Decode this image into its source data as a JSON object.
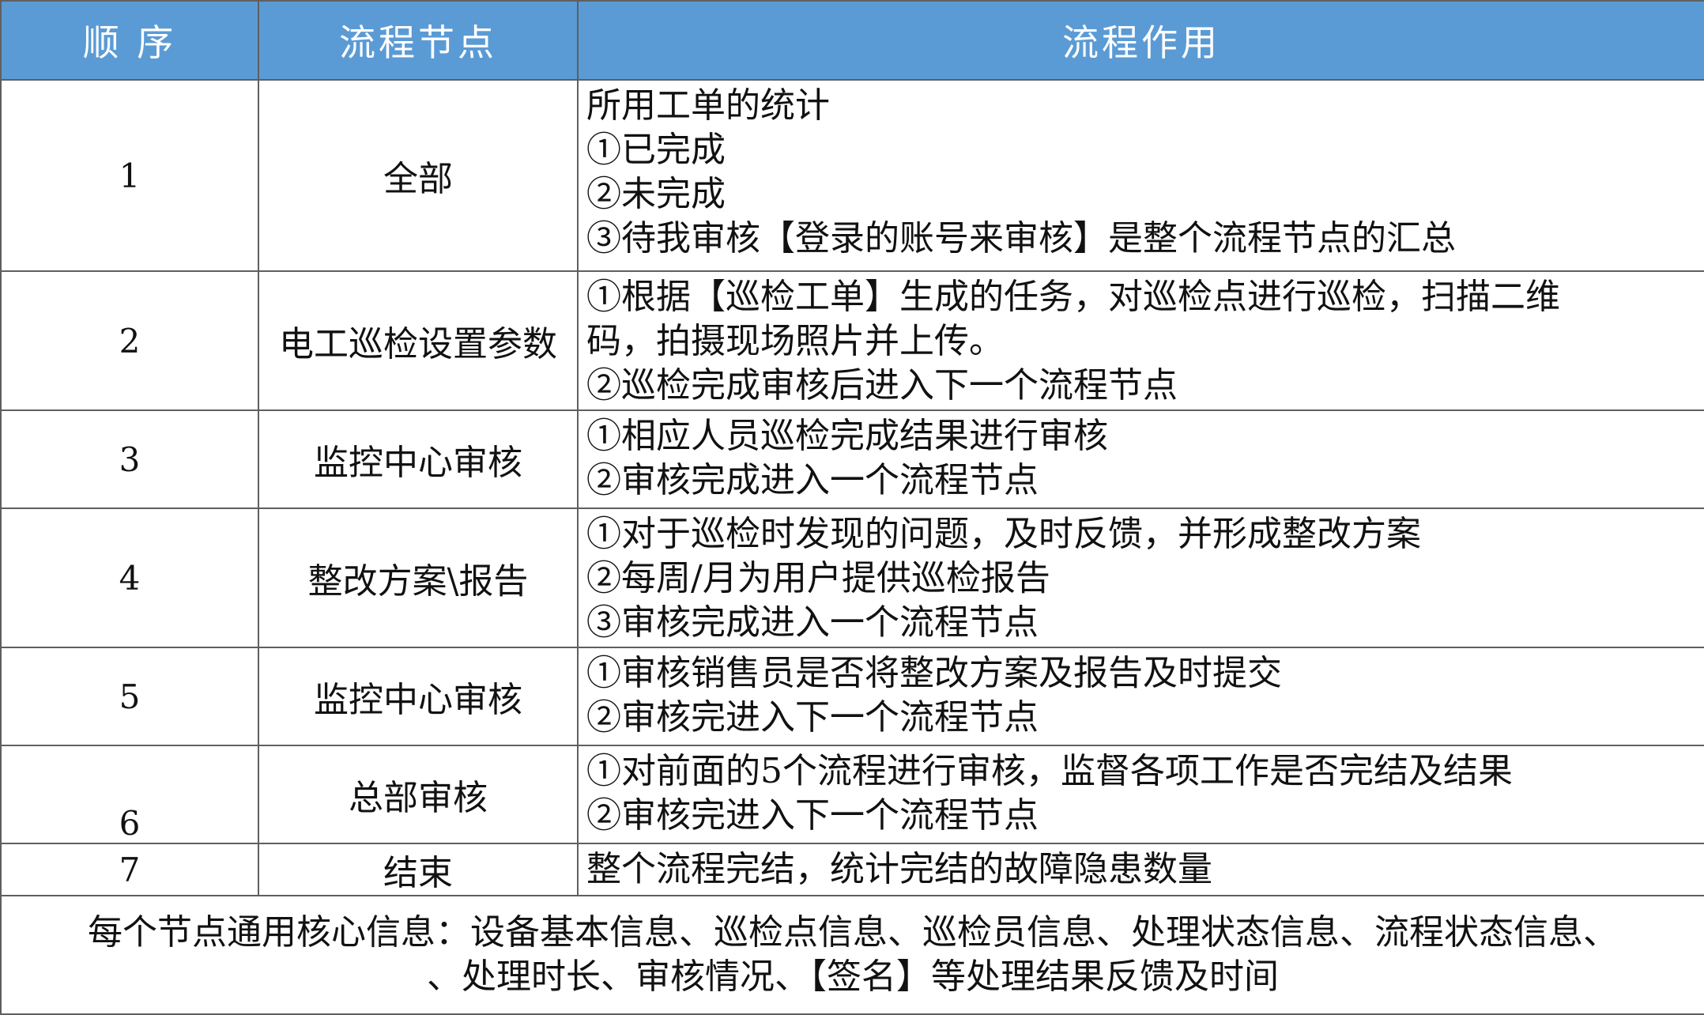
{
  "header": {
    "order": "顺 序",
    "node": "流程节点",
    "function": "流程作用"
  },
  "rows": [
    {
      "order": "1",
      "node": "全部",
      "lines": [
        "所用工单的统计",
        "①已完成",
        "②未完成",
        "③待我审核【登录的账号来审核】是整个流程节点的汇总"
      ]
    },
    {
      "order": "2",
      "node": "电工巡检设置参数",
      "lines": [
        "①根据【巡检工单】生成的任务，对巡检点进行巡检，扫描二维",
        "码，拍摄现场照片并上传。",
        "②巡检完成审核后进入下一个流程节点"
      ]
    },
    {
      "order": "3",
      "node": "监控中心审核",
      "lines": [
        "①相应人员巡检完成结果进行审核",
        "②审核完成进入一个流程节点"
      ]
    },
    {
      "order": "4",
      "node": "整改方案\\报告",
      "lines": [
        "①对于巡检时发现的问题，及时反馈，并形成整改方案",
        "②每周/月为用户提供巡检报告",
        "③审核完成进入一个流程节点"
      ]
    },
    {
      "order": "5",
      "node": "监控中心审核",
      "lines": [
        "①审核销售员是否将整改方案及报告及时提交",
        "②审核完进入下一个流程节点"
      ]
    },
    {
      "order": "6",
      "node": "总部审核",
      "lines": [
        "①对前面的5个流程进行审核，监督各项工作是否完结及结果",
        "②审核完进入下一个流程节点"
      ]
    },
    {
      "order": "7",
      "node": "结束",
      "lines": [
        "整个流程完结，统计完结的故障隐患数量"
      ]
    }
  ],
  "footer": {
    "line1": "每个节点通用核心信息：设备基本信息、巡检点信息、巡检员信息、处理状态信息、流程状态信息、",
    "line2": "、处理时长、审核情况、【签名】等处理结果反馈及时间"
  },
  "colors": {
    "header_bg": "#5b9bd5",
    "header_text": "#ffffff",
    "border": "#5f5f5f"
  }
}
